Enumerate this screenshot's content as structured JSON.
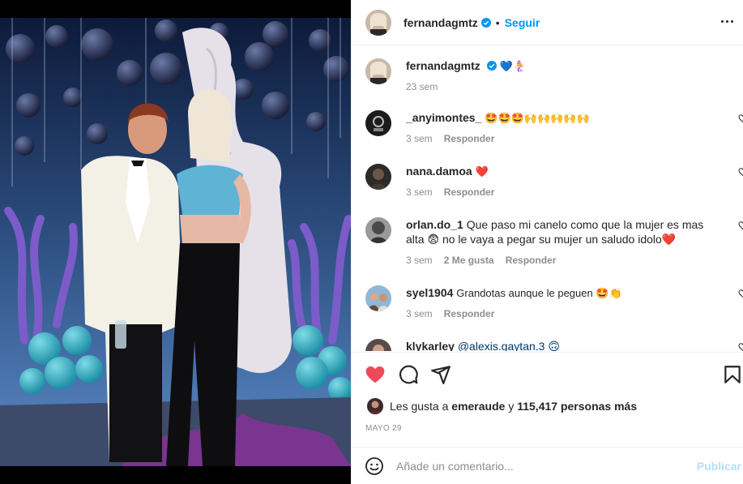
{
  "post": {
    "author": "fernandagmtz",
    "follow_label": "Seguir",
    "separator": "•",
    "caption_emojis": "💙🧜‍♀️",
    "caption_time": "23 sem"
  },
  "comments": [
    {
      "user": "_anyimontes_",
      "text": "🤩🤩🤩🙌🙌🙌🙌🙌",
      "time": "3 sem",
      "likes": "",
      "reply": "Responder"
    },
    {
      "user": "nana.damoa",
      "text": "❤️",
      "time": "3 sem",
      "likes": "",
      "reply": "Responder"
    },
    {
      "user": "orlan.do_1",
      "text": "Que paso mi canelo como que la mujer es mas alta 😨 no le vaya a pegar su mujer un saludo idolo❤️",
      "time": "3 sem",
      "likes": "2 Me gusta",
      "reply": "Responder"
    },
    {
      "user": "syel1904",
      "text": "Grandotas aunque le peguen 🤩👏",
      "time": "3 sem",
      "likes": "",
      "reply": "Responder"
    },
    {
      "user": "klykarley",
      "text": "@alexis.gaytan.3 🙃",
      "time": "",
      "likes": "",
      "reply": ""
    }
  ],
  "likes": {
    "prefix": "Les gusta a",
    "first_liker": "emeraude",
    "conjunction": "y",
    "others": "115,417 personas más"
  },
  "date": "MAYO 29",
  "composer": {
    "placeholder": "Añade un comentario...",
    "post_label": "Publicar"
  },
  "colors": {
    "accent": "#0095f6",
    "like_red": "#ed4956",
    "post_disabled": "#b2dffc",
    "muted": "#8e8e8e"
  },
  "icons": {
    "verified": "verified-badge-icon",
    "more": "more-options-icon",
    "like": "heart-filled-icon",
    "comment": "comment-icon",
    "share": "share-icon",
    "save": "bookmark-icon",
    "emoji": "emoji-icon",
    "comment_like": "heart-outline-icon"
  }
}
